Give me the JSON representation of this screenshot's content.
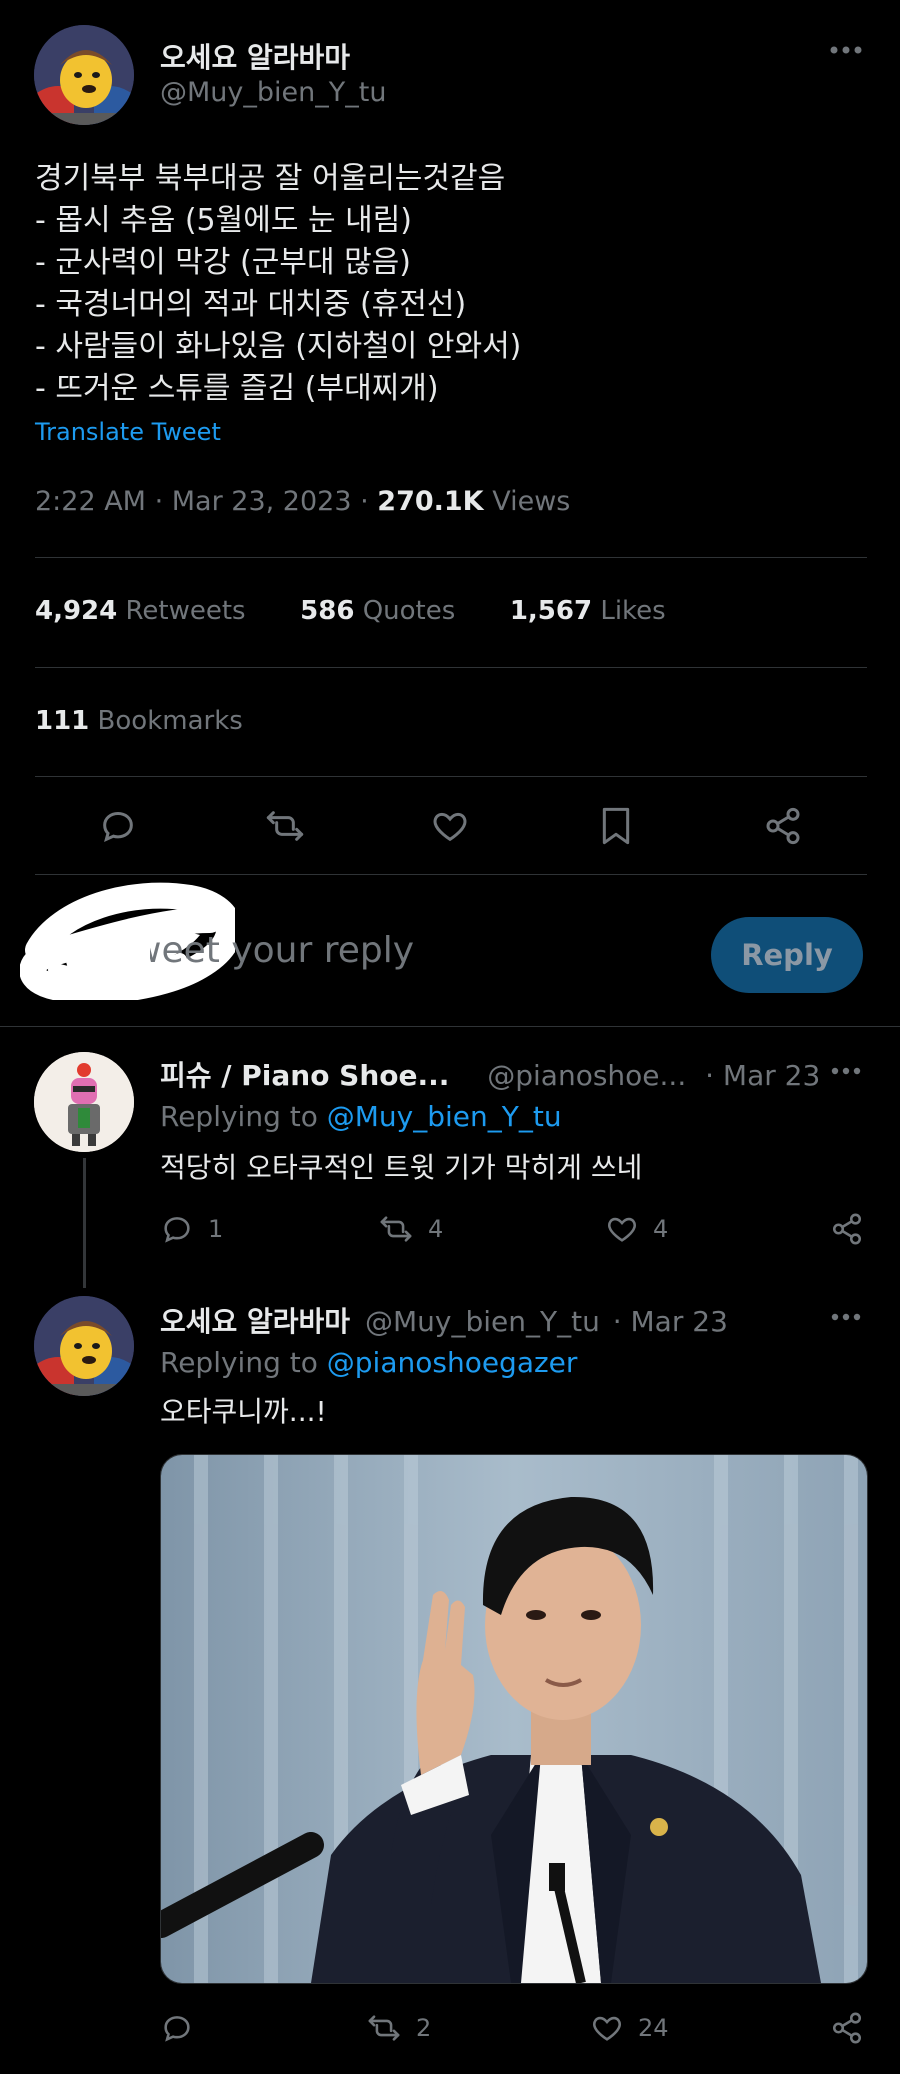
{
  "main_tweet": {
    "display_name": "오세요 알라바마",
    "handle": "@Muy_bien_Y_tu",
    "text_lines": [
      "경기북부 북부대공 잘 어울리는것같음",
      "- 몹시 추움 (5월에도 눈 내림)",
      "- 군사력이 막강 (군부대 많음)",
      "- 국경너머의 적과 대치중 (휴전선)",
      "- 사람들이 화나있음 (지하철이 안와서)",
      "- 뜨거운 스튜를 즐김 (부대찌개)"
    ],
    "translate_label": "Translate Tweet",
    "time": "2:22 AM",
    "date": "Mar 23, 2023",
    "views_count": "270.1K",
    "views_label": "Views",
    "stats": {
      "retweets_count": "4,924",
      "retweets_label": "Retweets",
      "quotes_count": "586",
      "quotes_label": "Quotes",
      "likes_count": "1,567",
      "likes_label": "Likes",
      "bookmarks_count": "111",
      "bookmarks_label": "Bookmarks"
    }
  },
  "reply_box": {
    "placeholder": "Tweet your reply",
    "button_label": "Reply"
  },
  "replies": [
    {
      "display_name": "피슈 / Piano Shoe...",
      "handle": "@pianoshoe...",
      "date": "· Mar 23",
      "replying_label": "Replying to",
      "replying_handle": "@Muy_bien_Y_tu",
      "text": "적당히 오타쿠적인 트윗 기가 막히게 쓰네",
      "reply_count": "1",
      "retweet_count": "4",
      "like_count": "4"
    },
    {
      "display_name": "오세요 알라바마",
      "handle": "@Muy_bien_Y_tu",
      "date": "· Mar 23",
      "replying_label": "Replying to",
      "replying_handle": "@pianoshoegazer",
      "text": "오타쿠니까...!",
      "reply_count": "",
      "retweet_count": "2",
      "like_count": "24"
    }
  ],
  "colors": {
    "background": "#000000",
    "text": "#e7e9ea",
    "muted": "#71767b",
    "accent": "#1d9bf0",
    "reply_button_bg": "#0f4e78"
  },
  "icons": [
    "more-icon",
    "reply-icon",
    "retweet-icon",
    "like-icon",
    "bookmark-icon",
    "share-icon"
  ]
}
